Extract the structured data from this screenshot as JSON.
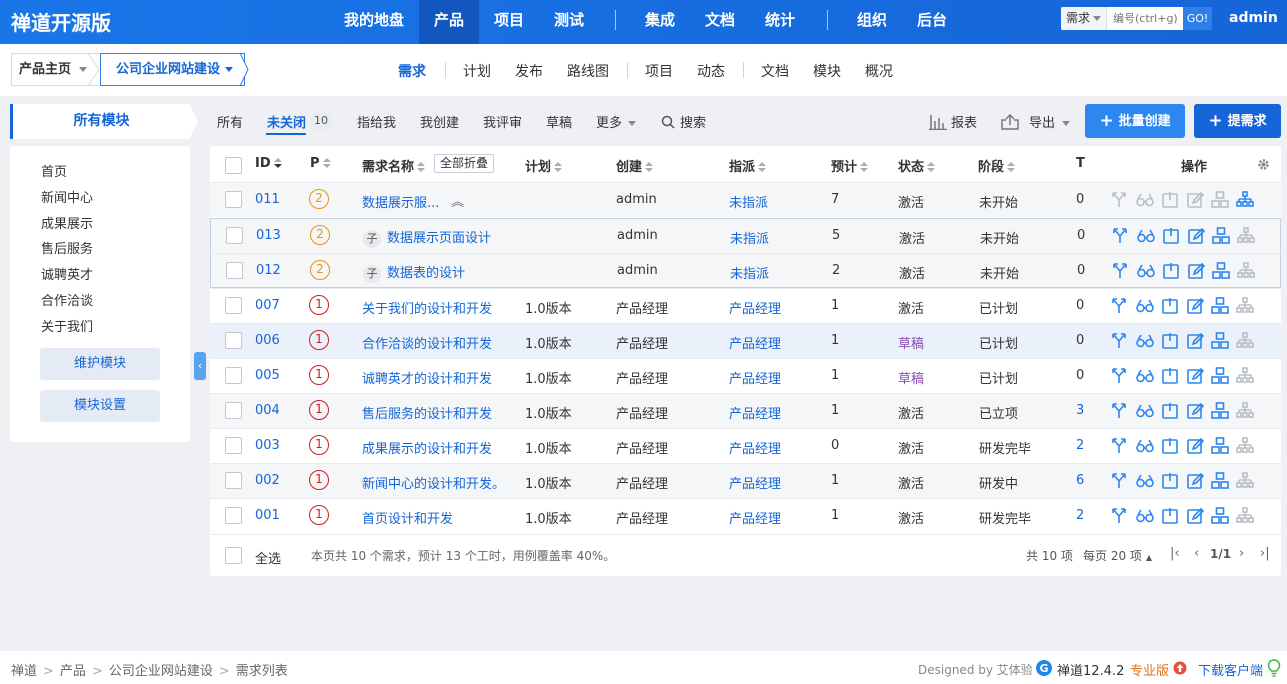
{
  "topbar": {
    "brand": "禅道开源版",
    "nav": [
      "我的地盘",
      "产品",
      "项目",
      "测试",
      "集成",
      "文档",
      "统计",
      "组织",
      "后台"
    ],
    "search_type": "需求",
    "search_placeholder": "编号(ctrl+g)",
    "search_go": "GO!",
    "user": "admin"
  },
  "subbar": {
    "crumb_home": "产品主页",
    "crumb_product": "公司企业网站建设",
    "items": [
      "需求",
      "计划",
      "发布",
      "路线图",
      "项目",
      "动态",
      "文档",
      "模块",
      "概况"
    ]
  },
  "left": {
    "title": "所有模块",
    "modules": [
      "首页",
      "新闻中心",
      "成果展示",
      "售后服务",
      "诚聘英才",
      "合作洽谈",
      "关于我们"
    ],
    "btn_maintain": "维护模块",
    "btn_settings": "模块设置"
  },
  "filters": {
    "all": "所有",
    "unclosed": "未关闭",
    "unclosed_count": "10",
    "assigned_me": "指给我",
    "created_me": "我创建",
    "reviewed_me": "我评审",
    "draft": "草稿",
    "more": "更多",
    "search": "搜索"
  },
  "toolbar": {
    "report": "报表",
    "export": "导出",
    "batch_create": "批量创建",
    "create": "提需求"
  },
  "table": {
    "headers": {
      "id": "ID",
      "p": "P",
      "name": "需求名称",
      "fold_all": "全部折叠",
      "plan": "计划",
      "creator": "创建",
      "assigned": "指派",
      "estimate": "预计",
      "status": "状态",
      "stage": "阶段",
      "t": "T",
      "actions": "操作"
    },
    "sub_tag": "子",
    "rows": [
      {
        "id": "011",
        "p": "2",
        "name": "数据展示服...",
        "plan": "",
        "creator": "admin",
        "assigned": "未指派",
        "estimate": "7",
        "status": "激活",
        "stage": "未开始",
        "t": "0"
      },
      {
        "id": "013",
        "p": "2",
        "name": "数据展示页面设计",
        "plan": "",
        "creator": "admin",
        "assigned": "未指派",
        "estimate": "5",
        "status": "激活",
        "stage": "未开始",
        "t": "0"
      },
      {
        "id": "012",
        "p": "2",
        "name": "数据表的设计",
        "plan": "",
        "creator": "admin",
        "assigned": "未指派",
        "estimate": "2",
        "status": "激活",
        "stage": "未开始",
        "t": "0"
      },
      {
        "id": "007",
        "p": "1",
        "name": "关于我们的设计和开发",
        "plan": "1.0版本",
        "creator": "产品经理",
        "assigned": "产品经理",
        "estimate": "1",
        "status": "激活",
        "stage": "已计划",
        "t": "0"
      },
      {
        "id": "006",
        "p": "1",
        "name": "合作洽谈的设计和开发",
        "plan": "1.0版本",
        "creator": "产品经理",
        "assigned": "产品经理",
        "estimate": "1",
        "status": "草稿",
        "stage": "已计划",
        "t": "0"
      },
      {
        "id": "005",
        "p": "1",
        "name": "诚聘英才的设计和开发",
        "plan": "1.0版本",
        "creator": "产品经理",
        "assigned": "产品经理",
        "estimate": "1",
        "status": "草稿",
        "stage": "已计划",
        "t": "0"
      },
      {
        "id": "004",
        "p": "1",
        "name": "售后服务的设计和开发",
        "plan": "1.0版本",
        "creator": "产品经理",
        "assigned": "产品经理",
        "estimate": "1",
        "status": "激活",
        "stage": "已立项",
        "t": "3"
      },
      {
        "id": "003",
        "p": "1",
        "name": "成果展示的设计和开发",
        "plan": "1.0版本",
        "creator": "产品经理",
        "assigned": "产品经理",
        "estimate": "0",
        "status": "激活",
        "stage": "研发完毕",
        "t": "2"
      },
      {
        "id": "002",
        "p": "1",
        "name": "新闻中心的设计和开发。",
        "plan": "1.0版本",
        "creator": "产品经理",
        "assigned": "产品经理",
        "estimate": "1",
        "status": "激活",
        "stage": "研发中",
        "t": "6"
      },
      {
        "id": "001",
        "p": "1",
        "name": "首页设计和开发",
        "plan": "1.0版本",
        "creator": "产品经理",
        "assigned": "产品经理",
        "estimate": "1",
        "status": "激活",
        "stage": "研发完毕",
        "t": "2"
      }
    ],
    "footer": {
      "select_all": "全选",
      "summary": "本页共 10 个需求，预计 13 个工时，用例覆盖率 40%。",
      "total": "共 10 项",
      "per_page": "每页 20 项",
      "page": "1/1"
    }
  },
  "bottom": {
    "breadcrumb": [
      "禅道",
      "产品",
      "公司企业网站建设",
      "需求列表"
    ],
    "designed_by": "Designed by 艾体验",
    "version": "禅道12.4.2",
    "edition": "专业版",
    "download": "下载客户端"
  },
  "colors": {
    "primary": "#1565d8",
    "p1": "#d01c1c",
    "p2": "#e8960d",
    "draft": "#8a4db8"
  }
}
